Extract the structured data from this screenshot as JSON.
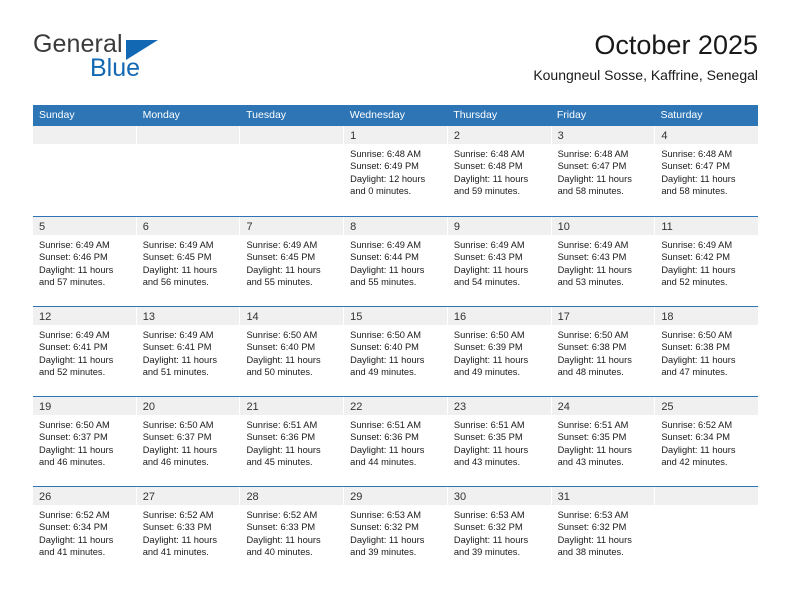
{
  "brand": {
    "name_top": "General",
    "name_bottom": "Blue",
    "color_dark": "#3b3b3b",
    "color_blue": "#1268b3"
  },
  "header": {
    "title": "October 2025",
    "subtitle": "Koungneul Sosse, Kaffrine, Senegal"
  },
  "theme": {
    "header_bg": "#2e75b6",
    "header_text": "#ffffff",
    "daynum_band_bg": "#f0f0f0",
    "row_divider": "#2e75b6",
    "cell_bg": "#ffffff"
  },
  "calendar": {
    "weekdays": [
      "Sunday",
      "Monday",
      "Tuesday",
      "Wednesday",
      "Thursday",
      "Friday",
      "Saturday"
    ],
    "weeks": [
      [
        {
          "day": "",
          "lines": []
        },
        {
          "day": "",
          "lines": []
        },
        {
          "day": "",
          "lines": []
        },
        {
          "day": "1",
          "lines": [
            "Sunrise: 6:48 AM",
            "Sunset: 6:49 PM",
            "Daylight: 12 hours",
            "and 0 minutes."
          ]
        },
        {
          "day": "2",
          "lines": [
            "Sunrise: 6:48 AM",
            "Sunset: 6:48 PM",
            "Daylight: 11 hours",
            "and 59 minutes."
          ]
        },
        {
          "day": "3",
          "lines": [
            "Sunrise: 6:48 AM",
            "Sunset: 6:47 PM",
            "Daylight: 11 hours",
            "and 58 minutes."
          ]
        },
        {
          "day": "4",
          "lines": [
            "Sunrise: 6:48 AM",
            "Sunset: 6:47 PM",
            "Daylight: 11 hours",
            "and 58 minutes."
          ]
        }
      ],
      [
        {
          "day": "5",
          "lines": [
            "Sunrise: 6:49 AM",
            "Sunset: 6:46 PM",
            "Daylight: 11 hours",
            "and 57 minutes."
          ]
        },
        {
          "day": "6",
          "lines": [
            "Sunrise: 6:49 AM",
            "Sunset: 6:45 PM",
            "Daylight: 11 hours",
            "and 56 minutes."
          ]
        },
        {
          "day": "7",
          "lines": [
            "Sunrise: 6:49 AM",
            "Sunset: 6:45 PM",
            "Daylight: 11 hours",
            "and 55 minutes."
          ]
        },
        {
          "day": "8",
          "lines": [
            "Sunrise: 6:49 AM",
            "Sunset: 6:44 PM",
            "Daylight: 11 hours",
            "and 55 minutes."
          ]
        },
        {
          "day": "9",
          "lines": [
            "Sunrise: 6:49 AM",
            "Sunset: 6:43 PM",
            "Daylight: 11 hours",
            "and 54 minutes."
          ]
        },
        {
          "day": "10",
          "lines": [
            "Sunrise: 6:49 AM",
            "Sunset: 6:43 PM",
            "Daylight: 11 hours",
            "and 53 minutes."
          ]
        },
        {
          "day": "11",
          "lines": [
            "Sunrise: 6:49 AM",
            "Sunset: 6:42 PM",
            "Daylight: 11 hours",
            "and 52 minutes."
          ]
        }
      ],
      [
        {
          "day": "12",
          "lines": [
            "Sunrise: 6:49 AM",
            "Sunset: 6:41 PM",
            "Daylight: 11 hours",
            "and 52 minutes."
          ]
        },
        {
          "day": "13",
          "lines": [
            "Sunrise: 6:49 AM",
            "Sunset: 6:41 PM",
            "Daylight: 11 hours",
            "and 51 minutes."
          ]
        },
        {
          "day": "14",
          "lines": [
            "Sunrise: 6:50 AM",
            "Sunset: 6:40 PM",
            "Daylight: 11 hours",
            "and 50 minutes."
          ]
        },
        {
          "day": "15",
          "lines": [
            "Sunrise: 6:50 AM",
            "Sunset: 6:40 PM",
            "Daylight: 11 hours",
            "and 49 minutes."
          ]
        },
        {
          "day": "16",
          "lines": [
            "Sunrise: 6:50 AM",
            "Sunset: 6:39 PM",
            "Daylight: 11 hours",
            "and 49 minutes."
          ]
        },
        {
          "day": "17",
          "lines": [
            "Sunrise: 6:50 AM",
            "Sunset: 6:38 PM",
            "Daylight: 11 hours",
            "and 48 minutes."
          ]
        },
        {
          "day": "18",
          "lines": [
            "Sunrise: 6:50 AM",
            "Sunset: 6:38 PM",
            "Daylight: 11 hours",
            "and 47 minutes."
          ]
        }
      ],
      [
        {
          "day": "19",
          "lines": [
            "Sunrise: 6:50 AM",
            "Sunset: 6:37 PM",
            "Daylight: 11 hours",
            "and 46 minutes."
          ]
        },
        {
          "day": "20",
          "lines": [
            "Sunrise: 6:50 AM",
            "Sunset: 6:37 PM",
            "Daylight: 11 hours",
            "and 46 minutes."
          ]
        },
        {
          "day": "21",
          "lines": [
            "Sunrise: 6:51 AM",
            "Sunset: 6:36 PM",
            "Daylight: 11 hours",
            "and 45 minutes."
          ]
        },
        {
          "day": "22",
          "lines": [
            "Sunrise: 6:51 AM",
            "Sunset: 6:36 PM",
            "Daylight: 11 hours",
            "and 44 minutes."
          ]
        },
        {
          "day": "23",
          "lines": [
            "Sunrise: 6:51 AM",
            "Sunset: 6:35 PM",
            "Daylight: 11 hours",
            "and 43 minutes."
          ]
        },
        {
          "day": "24",
          "lines": [
            "Sunrise: 6:51 AM",
            "Sunset: 6:35 PM",
            "Daylight: 11 hours",
            "and 43 minutes."
          ]
        },
        {
          "day": "25",
          "lines": [
            "Sunrise: 6:52 AM",
            "Sunset: 6:34 PM",
            "Daylight: 11 hours",
            "and 42 minutes."
          ]
        }
      ],
      [
        {
          "day": "26",
          "lines": [
            "Sunrise: 6:52 AM",
            "Sunset: 6:34 PM",
            "Daylight: 11 hours",
            "and 41 minutes."
          ]
        },
        {
          "day": "27",
          "lines": [
            "Sunrise: 6:52 AM",
            "Sunset: 6:33 PM",
            "Daylight: 11 hours",
            "and 41 minutes."
          ]
        },
        {
          "day": "28",
          "lines": [
            "Sunrise: 6:52 AM",
            "Sunset: 6:33 PM",
            "Daylight: 11 hours",
            "and 40 minutes."
          ]
        },
        {
          "day": "29",
          "lines": [
            "Sunrise: 6:53 AM",
            "Sunset: 6:32 PM",
            "Daylight: 11 hours",
            "and 39 minutes."
          ]
        },
        {
          "day": "30",
          "lines": [
            "Sunrise: 6:53 AM",
            "Sunset: 6:32 PM",
            "Daylight: 11 hours",
            "and 39 minutes."
          ]
        },
        {
          "day": "31",
          "lines": [
            "Sunrise: 6:53 AM",
            "Sunset: 6:32 PM",
            "Daylight: 11 hours",
            "and 38 minutes."
          ]
        },
        {
          "day": "",
          "lines": []
        }
      ]
    ]
  }
}
